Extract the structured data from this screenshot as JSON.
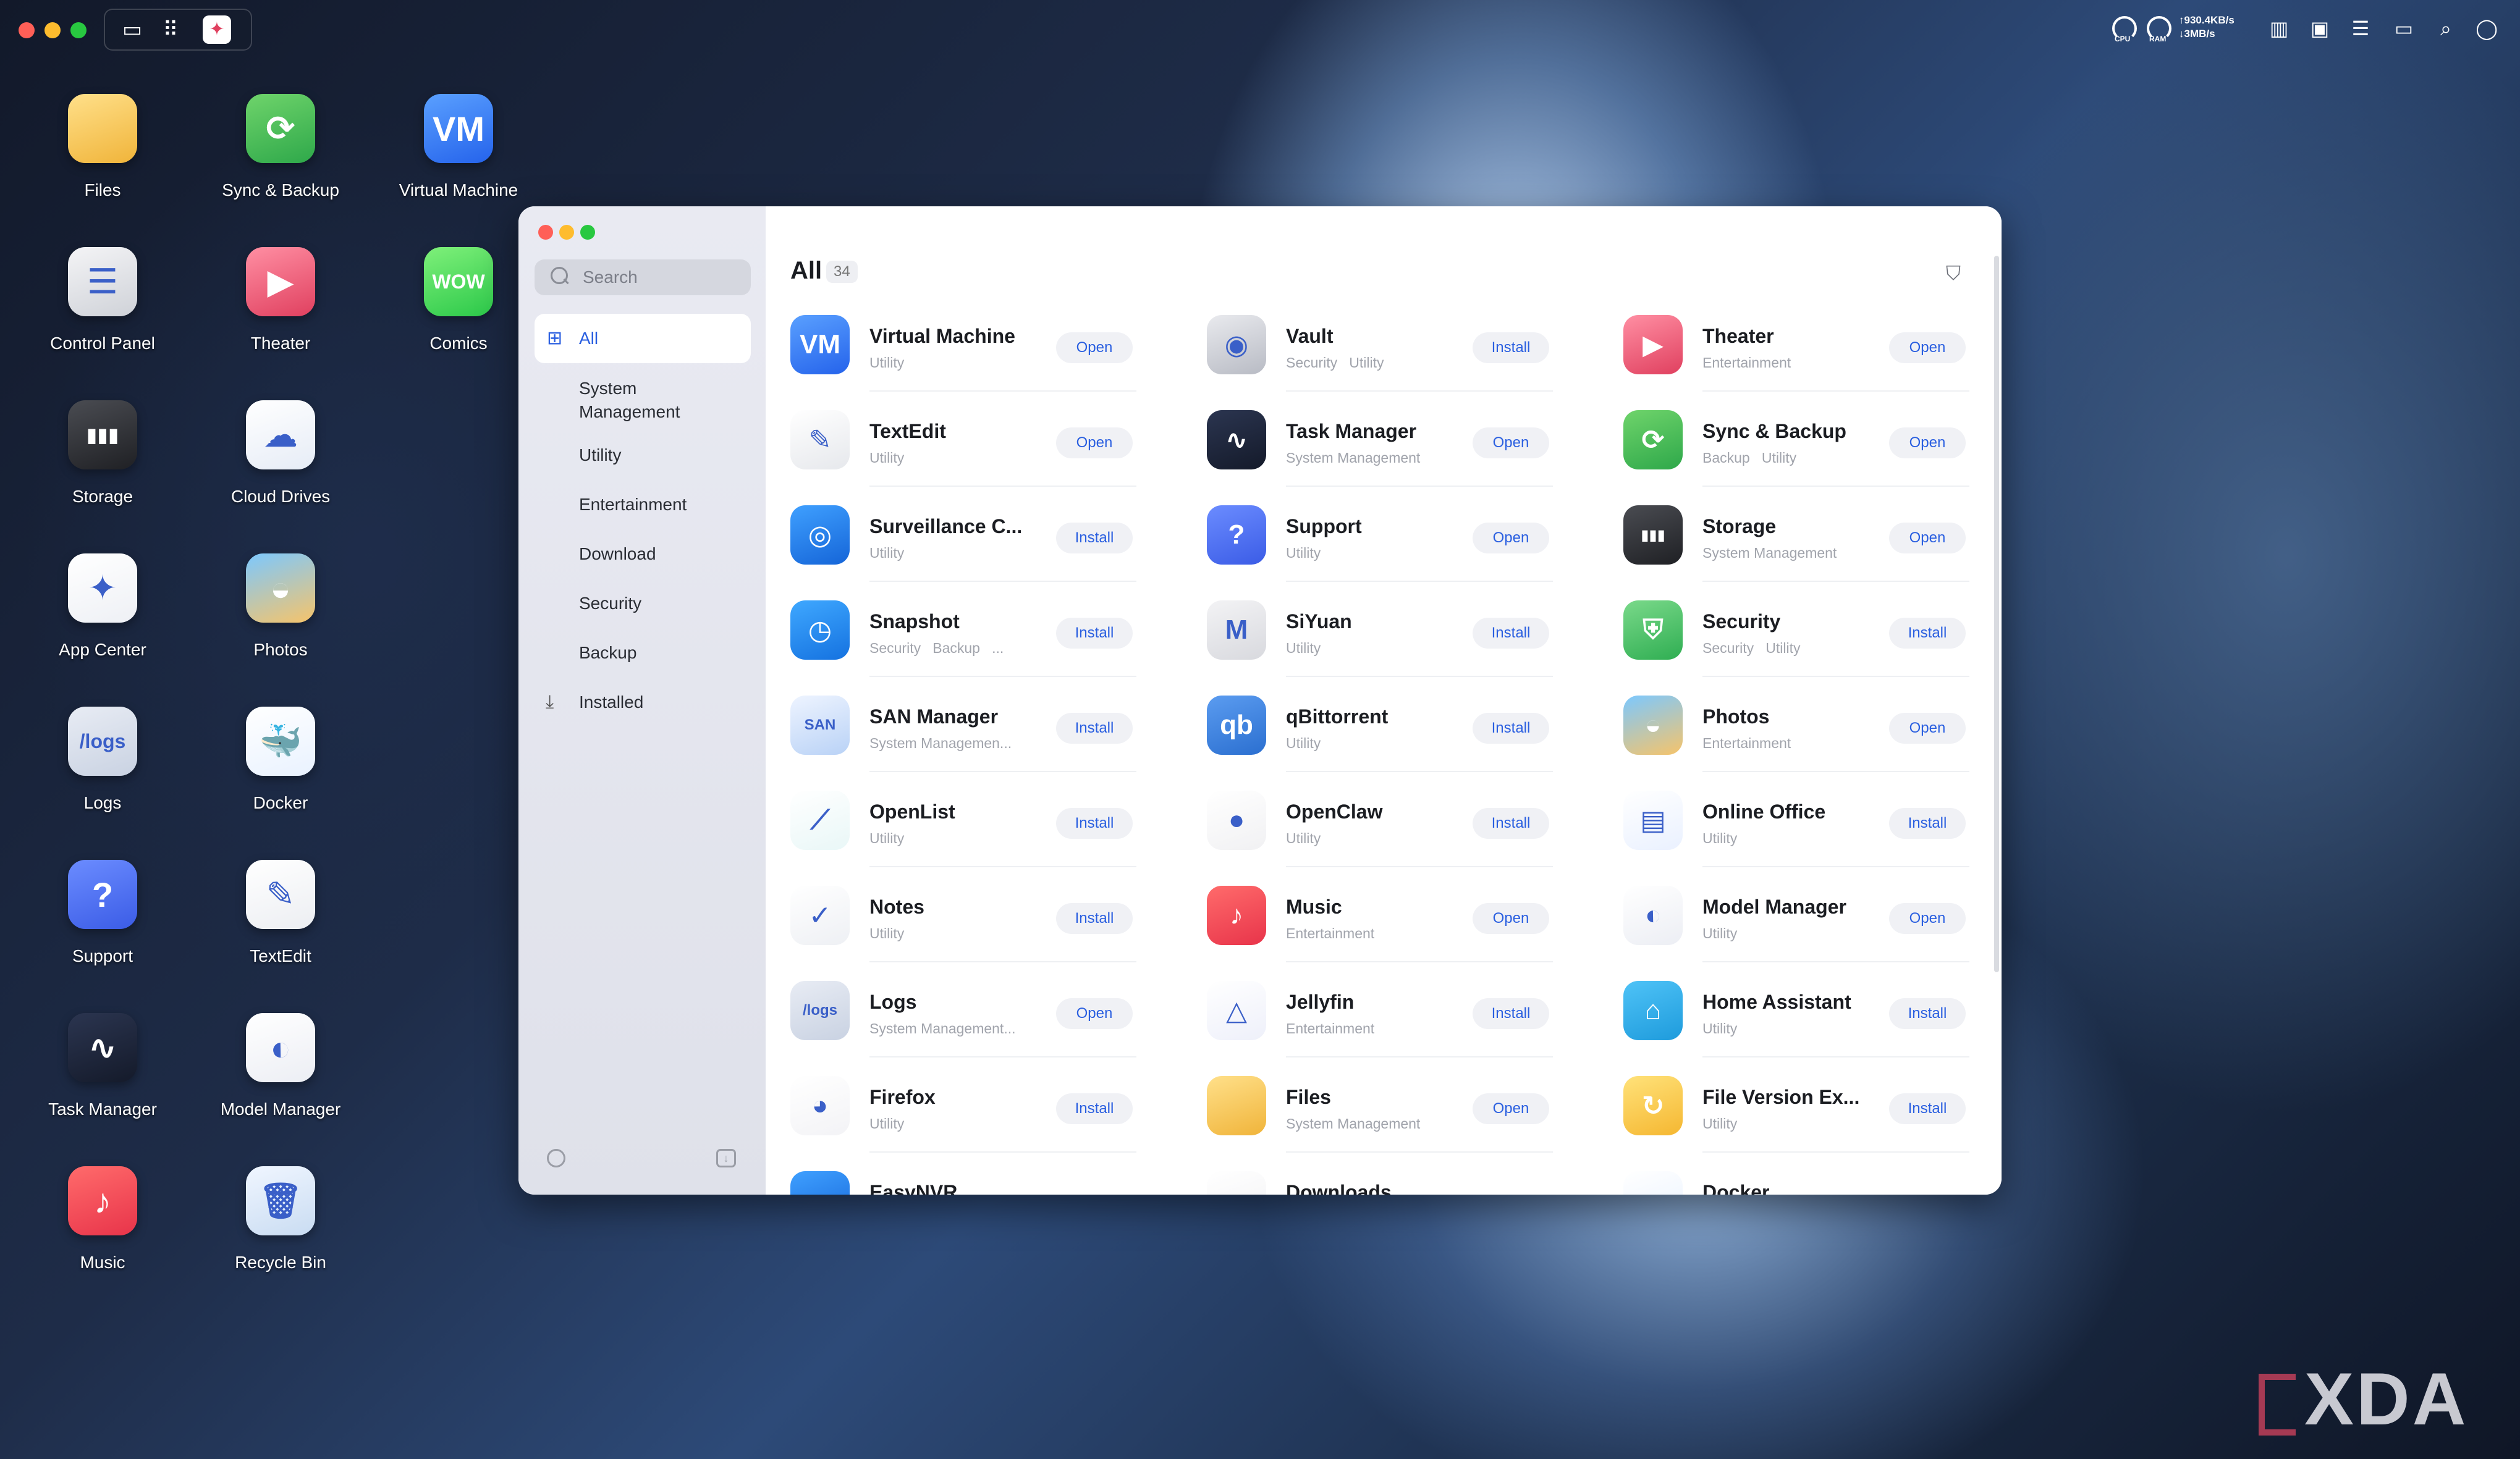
{
  "desktop_icons": [
    {
      "label": "Files",
      "glyph": "",
      "colors": [
        "#ffe08a",
        "#f0b43a"
      ]
    },
    {
      "label": "Sync & Backup",
      "glyph": "⟳",
      "colors": [
        "#6fd46b",
        "#2ea84a"
      ]
    },
    {
      "label": "Virtual Machine",
      "glyph": "VM",
      "colors": [
        "#5aa0ff",
        "#2563eb"
      ]
    },
    {
      "label": "Control Panel",
      "glyph": "☰",
      "colors": [
        "#f4f4f6",
        "#cfd2d8"
      ]
    },
    {
      "label": "Theater",
      "glyph": "▶",
      "colors": [
        "#ff8fa3",
        "#e0405f"
      ]
    },
    {
      "label": "Comics",
      "glyph": "WOW",
      "colors": [
        "#7ff07a",
        "#2cc94a"
      ]
    },
    {
      "label": "Storage",
      "glyph": "▮▮▮",
      "colors": [
        "#4a4c52",
        "#1f2024"
      ]
    },
    {
      "label": "Cloud Drives",
      "glyph": "☁",
      "colors": [
        "#ffffff",
        "#e6ecf6"
      ]
    },
    {
      "label": "App Center",
      "glyph": "✦",
      "colors": [
        "#ffffff",
        "#eef0f5"
      ]
    },
    {
      "label": "Photos",
      "glyph": "◒",
      "colors": [
        "#7cc8ff",
        "#f6c46a"
      ]
    },
    {
      "label": "Logs",
      "glyph": "/logs",
      "colors": [
        "#e8ecf4",
        "#c9d2e2"
      ]
    },
    {
      "label": "Docker",
      "glyph": "🐳",
      "colors": [
        "#ffffff",
        "#e9f2ff"
      ]
    },
    {
      "label": "Support",
      "glyph": "?",
      "colors": [
        "#6b8cff",
        "#3b5ce6"
      ]
    },
    {
      "label": "TextEdit",
      "glyph": "✎",
      "colors": [
        "#ffffff",
        "#eceef2"
      ]
    },
    {
      "label": "Task Manager",
      "glyph": "∿",
      "colors": [
        "#2b3550",
        "#141a2a"
      ]
    },
    {
      "label": "Model Manager",
      "glyph": "◐",
      "colors": [
        "#ffffff",
        "#eceef4"
      ]
    },
    {
      "label": "Music",
      "glyph": "♪",
      "colors": [
        "#ff6b6b",
        "#e8344a"
      ]
    },
    {
      "label": "Recycle Bin",
      "glyph": "🗑",
      "colors": [
        "#f0f6ff",
        "#c9dcf2"
      ]
    }
  ],
  "window": {
    "search_placeholder": "Search",
    "nav": [
      "All",
      "System Management",
      "Utility",
      "Entertainment",
      "Download",
      "Security",
      "Backup",
      "Installed"
    ],
    "title": "All",
    "count": "34",
    "apps": [
      {
        "name": "Virtual Machine",
        "cat": "Utility",
        "btn": "Open",
        "glyph": "VM",
        "colors": [
          "#5aa0ff",
          "#2563eb"
        ]
      },
      {
        "name": "Vault",
        "cat": "Security   Utility",
        "btn": "Install",
        "glyph": "◉",
        "colors": [
          "#e9eaee",
          "#b8bbc4"
        ]
      },
      {
        "name": "Theater",
        "cat": "Entertainment",
        "btn": "Open",
        "glyph": "▶",
        "colors": [
          "#ff8fa3",
          "#e0405f"
        ]
      },
      {
        "name": "TextEdit",
        "cat": "Utility",
        "btn": "Open",
        "glyph": "✎",
        "colors": [
          "#ffffff",
          "#e6e8ec"
        ]
      },
      {
        "name": "Task Manager",
        "cat": "System Management",
        "btn": "Open",
        "glyph": "∿",
        "colors": [
          "#2b3550",
          "#141a2a"
        ]
      },
      {
        "name": "Sync & Backup",
        "cat": "Backup   Utility",
        "btn": "Open",
        "glyph": "⟳",
        "colors": [
          "#6fd46b",
          "#2ea84a"
        ]
      },
      {
        "name": "Surveillance C...",
        "cat": "Utility",
        "btn": "Install",
        "glyph": "◎",
        "colors": [
          "#3fa0ff",
          "#1565d8"
        ]
      },
      {
        "name": "Support",
        "cat": "Utility",
        "btn": "Open",
        "glyph": "?",
        "colors": [
          "#6b8cff",
          "#3b5ce6"
        ]
      },
      {
        "name": "Storage",
        "cat": "System Management",
        "btn": "Open",
        "glyph": "▮▮▮",
        "colors": [
          "#4a4c52",
          "#1f2024"
        ]
      },
      {
        "name": "Snapshot",
        "cat": "Security   Backup   ...",
        "btn": "Install",
        "glyph": "◷",
        "colors": [
          "#3fa8ff",
          "#1572e0"
        ]
      },
      {
        "name": "SiYuan",
        "cat": "Utility",
        "btn": "Install",
        "glyph": "M",
        "colors": [
          "#f3f3f5",
          "#d8d9de"
        ]
      },
      {
        "name": "Security",
        "cat": "Security   Utility",
        "btn": "Install",
        "glyph": "⛨",
        "colors": [
          "#7ad98a",
          "#2fae52"
        ]
      },
      {
        "name": "SAN Manager",
        "cat": "System Managemen...",
        "btn": "Install",
        "glyph": "SAN",
        "colors": [
          "#eef4ff",
          "#b9d2f6"
        ]
      },
      {
        "name": "qBittorrent",
        "cat": "Utility",
        "btn": "Install",
        "glyph": "qb",
        "colors": [
          "#5b9cf0",
          "#2b6fd0"
        ]
      },
      {
        "name": "Photos",
        "cat": "Entertainment",
        "btn": "Open",
        "glyph": "◒",
        "colors": [
          "#7cc8ff",
          "#f6c46a"
        ]
      },
      {
        "name": "OpenList",
        "cat": "Utility",
        "btn": "Install",
        "glyph": "⟋",
        "colors": [
          "#ffffff",
          "#e9f7f7"
        ]
      },
      {
        "name": "OpenClaw",
        "cat": "Utility",
        "btn": "Install",
        "glyph": "●",
        "colors": [
          "#ffffff",
          "#f1f1f3"
        ]
      },
      {
        "name": "Online Office",
        "cat": "Utility",
        "btn": "Install",
        "glyph": "▤",
        "colors": [
          "#ffffff",
          "#eaf1ff"
        ]
      },
      {
        "name": "Notes",
        "cat": "Utility",
        "btn": "Install",
        "glyph": "✓",
        "colors": [
          "#ffffff",
          "#eef0f4"
        ]
      },
      {
        "name": "Music",
        "cat": "Entertainment",
        "btn": "Open",
        "glyph": "♪",
        "colors": [
          "#ff6b6b",
          "#e8344a"
        ]
      },
      {
        "name": "Model Manager",
        "cat": "Utility",
        "btn": "Open",
        "glyph": "◐",
        "colors": [
          "#ffffff",
          "#eceef4"
        ]
      },
      {
        "name": "Logs",
        "cat": "System Management...",
        "btn": "Open",
        "glyph": "/logs",
        "colors": [
          "#e8ecf4",
          "#c9d2e2"
        ]
      },
      {
        "name": "Jellyfin",
        "cat": "Entertainment",
        "btn": "Install",
        "glyph": "△",
        "colors": [
          "#ffffff",
          "#eef0fa"
        ]
      },
      {
        "name": "Home Assistant",
        "cat": "Utility",
        "btn": "Install",
        "glyph": "⌂",
        "colors": [
          "#4fc3f7",
          "#1e9bdc"
        ]
      },
      {
        "name": "Firefox",
        "cat": "Utility",
        "btn": "Install",
        "glyph": "◕",
        "colors": [
          "#ffffff",
          "#f3f3f6"
        ]
      },
      {
        "name": "Files",
        "cat": "System Management",
        "btn": "Open",
        "glyph": "",
        "colors": [
          "#ffe08a",
          "#f0b43a"
        ]
      },
      {
        "name": "File Version Ex...",
        "cat": "Utility",
        "btn": "Install",
        "glyph": "↻",
        "colors": [
          "#ffe27a",
          "#f5b731"
        ]
      },
      {
        "name": "EasyNVR",
        "cat": "",
        "btn": "",
        "glyph": "",
        "colors": [
          "#3fa0ff",
          "#1565d8"
        ]
      },
      {
        "name": "Downloads",
        "cat": "",
        "btn": "",
        "glyph": "",
        "colors": [
          "#ffffff",
          "#f2f2f4"
        ]
      },
      {
        "name": "Docker",
        "cat": "",
        "btn": "",
        "glyph": "",
        "colors": [
          "#ffffff",
          "#e9f2ff"
        ]
      }
    ]
  },
  "topbar": {
    "net_up": "↑930.4KB/s",
    "net_down": "↓3MB/s",
    "cpu_label": "CPU",
    "ram_label": "RAM"
  },
  "watermark": "XDA"
}
